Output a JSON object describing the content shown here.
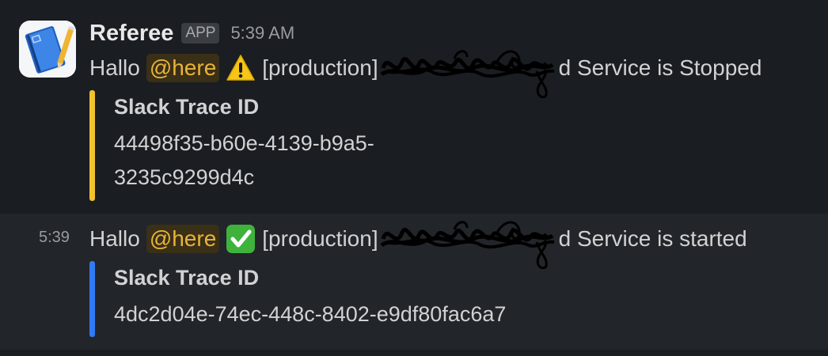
{
  "messages": [
    {
      "sender": "Referee",
      "badge": "APP",
      "time": "5:39 AM",
      "greeting": "Hallo",
      "mention": "@here",
      "emoji_icon": "warning-icon",
      "env": "[production]",
      "status_text": "d Service is Stopped",
      "attachment": {
        "title": "Slack Trace ID",
        "value": "44498f35-b60e-4139-b9a5-3235c9299d4c",
        "value_line1": "44498f35-b60e-4139-b9a5-",
        "value_line2": "3235c9299d4c",
        "color": "#f2c12e"
      }
    },
    {
      "hover_time": "5:39",
      "greeting": "Hallo",
      "mention": "@here",
      "emoji_icon": "check-mark-button-icon",
      "env": "[production]",
      "status_text": "d Service is started",
      "attachment": {
        "title": "Slack Trace ID",
        "value": "4dc2d04e-74ec-448c-8402-e9df80fac6a7",
        "color": "#2f7bf5"
      }
    }
  ],
  "colors": {
    "background": "#1a1d21",
    "hover_background": "#222529",
    "mention_text": "#e8b339",
    "mention_bg": "#3a2f17"
  }
}
